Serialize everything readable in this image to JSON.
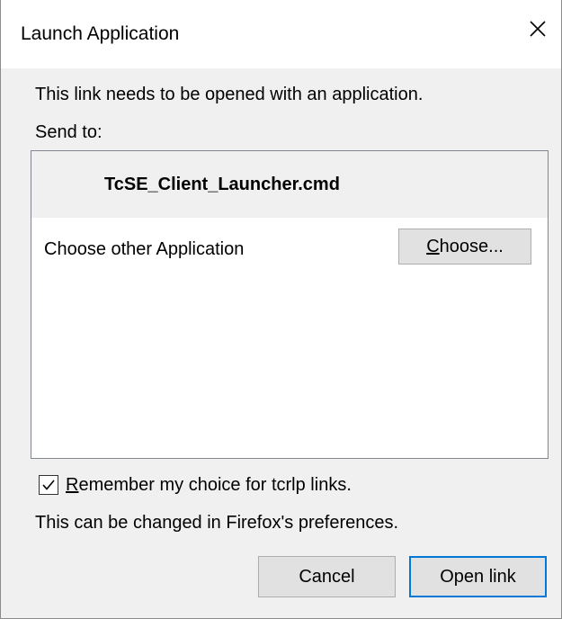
{
  "dialog": {
    "title": "Launch Application",
    "close_icon": "close-icon",
    "message": "This link needs to be opened with an application.",
    "send_to_label": "Send to:",
    "applications": [
      {
        "name": "TcSE_Client_Launcher.cmd",
        "selected": true
      }
    ],
    "choose_other_label": "Choose other Application",
    "choose_button": {
      "mnemonic": "C",
      "rest": "hoose..."
    },
    "remember": {
      "checked": true,
      "mnemonic": "R",
      "rest": "emember my choice for tcrlp links."
    },
    "preferences_note": "This can be changed in Firefox's preferences.",
    "buttons": {
      "cancel": "Cancel",
      "open": "Open link"
    }
  },
  "colors": {
    "background": "#f0f0f0",
    "titlebar": "#ffffff",
    "button_face": "#e1e1e1",
    "default_button_border": "#0078d7"
  }
}
